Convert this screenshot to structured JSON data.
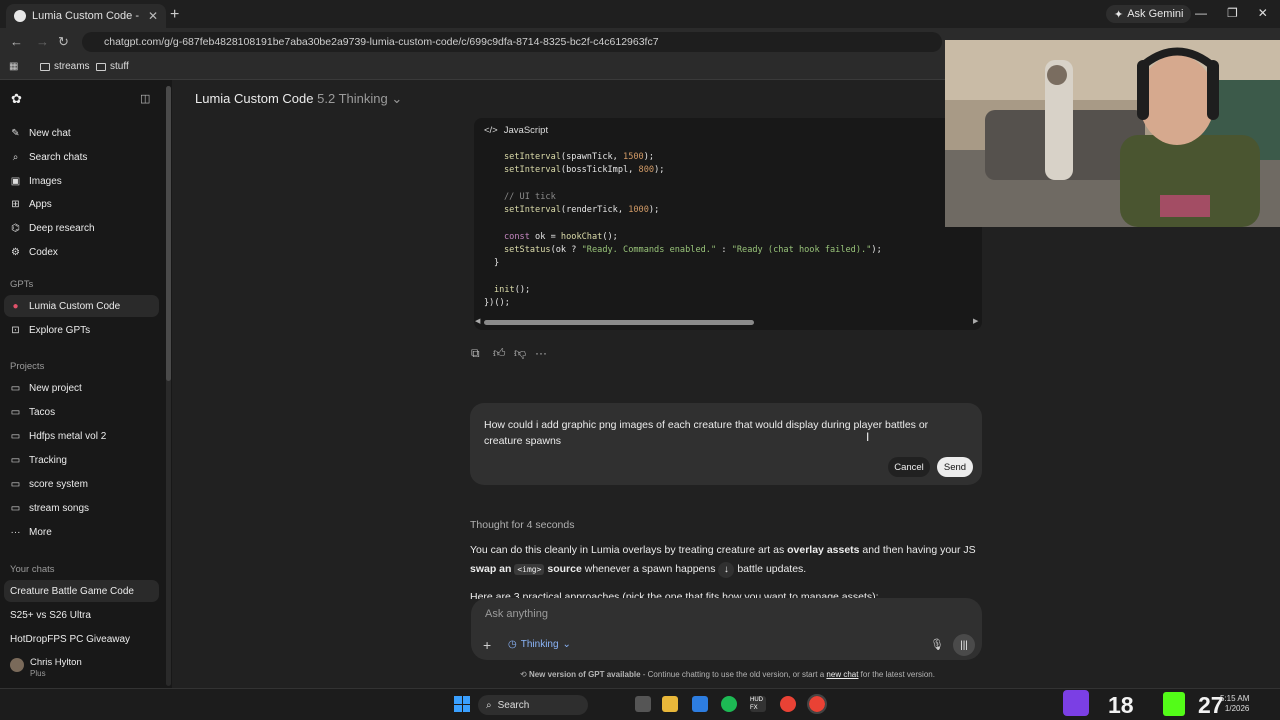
{
  "browser": {
    "tab_title": "Lumia Custom Code - Creature",
    "url": "chatgpt.com/g/g-687feb4828108191be7aba30be2a9739-lumia-custom-code/c/699c9dfa-8714-8325-bc2f-c4c612963fc7",
    "ask_gemini": "Ask Gemini",
    "bookmarks": [
      "streams",
      "stuff"
    ]
  },
  "sidebar": {
    "top_items": [
      {
        "icon": "edit-icon",
        "label": "New chat"
      },
      {
        "icon": "search-icon",
        "label": "Search chats"
      },
      {
        "icon": "images-icon",
        "label": "Images"
      },
      {
        "icon": "apps-icon",
        "label": "Apps"
      },
      {
        "icon": "research-icon",
        "label": "Deep research"
      },
      {
        "icon": "codex-icon",
        "label": "Codex"
      }
    ],
    "gpts_heading": "GPTs",
    "gpts": [
      {
        "label": "Lumia Custom Code"
      },
      {
        "label": "Explore GPTs"
      }
    ],
    "projects_heading": "Projects",
    "projects": [
      "New project",
      "Tacos",
      "Hdfps metal vol 2",
      "Tracking",
      "score system",
      "stream songs",
      "More"
    ],
    "chats_heading": "Your chats",
    "chats": [
      "Creature Battle Game Code",
      "S25+ vs S26 Ultra",
      "HotDropFPS PC Giveaway"
    ],
    "user": {
      "name": "Chris Hylton",
      "plan": "Plus"
    }
  },
  "header": {
    "model_name": "Lumia Custom Code",
    "model_version": "5.2 Thinking"
  },
  "code": {
    "language": "JavaScript",
    "lines": [
      "setInterval(spawnTick, 1500);",
      "setInterval(bossTickImpl, 800);",
      "// UI tick",
      "setInterval(renderTick, 1000);",
      "const ok = hookChat();",
      "setStatus(ok ? \"Ready. Commands enabled.\" : \"Ready (chat hook failed).\");",
      "}",
      "init();",
      "})();"
    ]
  },
  "edit": {
    "text": "How could i add graphic png images of each creature that would display during player battles or creature spawns",
    "cancel": "Cancel",
    "send": "Send"
  },
  "response": {
    "thought": "Thought for 4 seconds",
    "p1_a": "You can do this cleanly in Lumia overlays by treating creature art as ",
    "p1_b": "overlay assets",
    "p1_c": " and then having your JS ",
    "p1_d": "swap an",
    "p1_chip": "<img>",
    "p1_e": "source",
    "p1_f": " whenever a spawn happens",
    "p1_g": " battle updates.",
    "p2": "Here are 3 practical approaches (pick the one that fits how you want to manage assets):"
  },
  "composer": {
    "placeholder": "Ask anything",
    "mode": "Thinking"
  },
  "notice": {
    "bold": "New version of GPT available",
    "text": " - Continue chatting to use the old version, or start a ",
    "link": "new chat",
    "end": " for the latest version."
  },
  "taskbar": {
    "search": "Search",
    "counter_a": "18",
    "counter_b": "27",
    "time": "5:15 AM",
    "date": "1/2026"
  }
}
